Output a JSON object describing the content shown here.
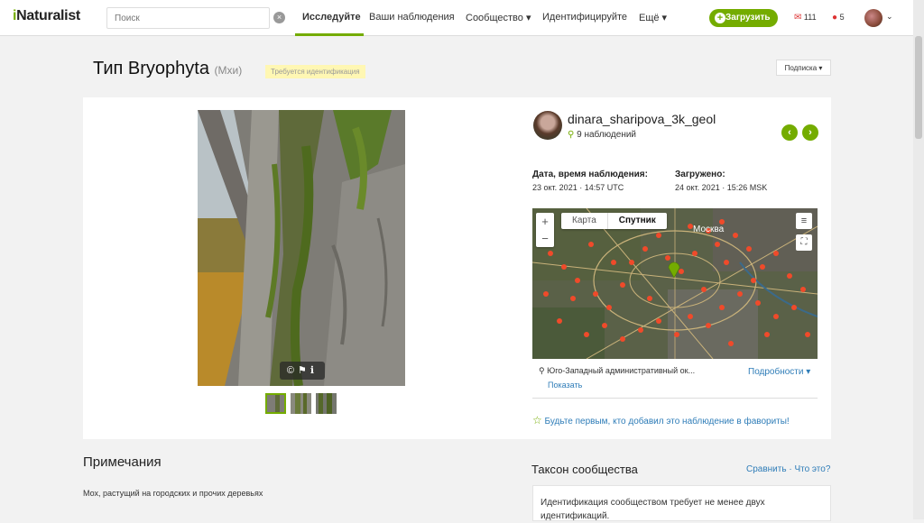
{
  "header": {
    "logo": "iNaturalist",
    "search_placeholder": "Поиск",
    "nav": [
      "Исследуйте",
      "Ваши наблюдения",
      "Сообщество ▾",
      "Идентифицируйте",
      "Ещё ▾"
    ],
    "upload": "Загрузить",
    "mail_count": "111",
    "chat_count": "5"
  },
  "title": {
    "rank": "Тип",
    "name": "Bryophyta",
    "common": "(Мхи)",
    "badge": "Требуется идентификация",
    "subscribe": "Подписка ▾"
  },
  "photo": {
    "controls": "©⚑ℹ"
  },
  "observer": {
    "name": "dinara_sharipova_3k_geol",
    "count": "9 наблюдений"
  },
  "dates": {
    "observed_label": "Дата, время наблюдения:",
    "observed_value": "23 окт. 2021 · 14:57 UTC",
    "uploaded_label": "Загружено:",
    "uploaded_value": "24 окт. 2021 · 15:26 MSK"
  },
  "map": {
    "type_map": "Карта",
    "type_sat": "Спутник",
    "city": "Москва"
  },
  "location": {
    "place": "Юго-Западный административный ок...",
    "show": "Показать",
    "details": "Подробности ▾"
  },
  "favorite": "Будьте первым, кто добавил это наблюдение в фавориты!",
  "notes": {
    "heading": "Примечания",
    "text": "Мох, растущий на городских и прочих деревьях"
  },
  "taxon": {
    "heading": "Таксон сообщества",
    "compare": "Сравнить",
    "what": "· Что это?",
    "text": "Идентификация сообществом требует не менее двух идентификаций."
  },
  "colors": {
    "accent": "#74ac00",
    "link": "#2f7db8"
  }
}
